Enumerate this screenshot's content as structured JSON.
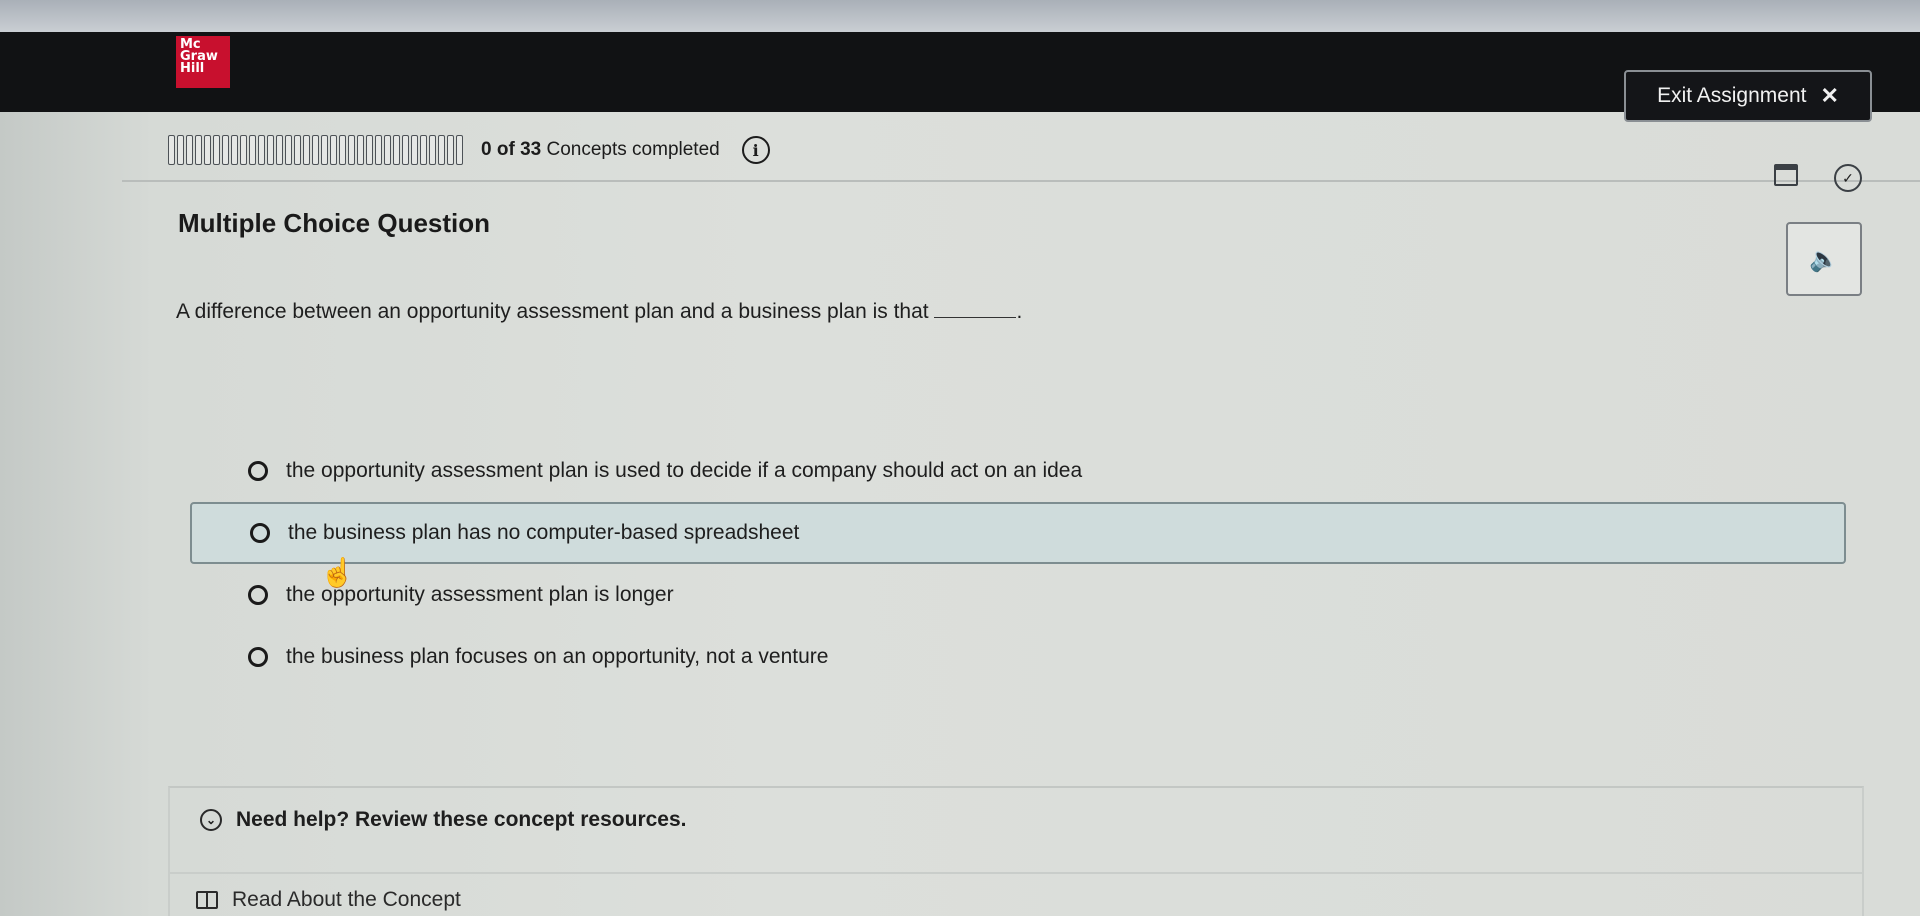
{
  "header": {
    "logo": {
      "line1": "Mc",
      "line2": "Graw",
      "line3": "Hill"
    },
    "exit_label": "Exit Assignment",
    "exit_icon": "close-icon"
  },
  "progress": {
    "completed": "0",
    "of_label": "of",
    "total": "33",
    "label": "Concepts completed",
    "segments": 33,
    "info_symbol": "i"
  },
  "question": {
    "heading": "Multiple Choice Question",
    "prompt": "A difference between an opportunity assessment plan and a business plan is that",
    "prompt_end": "."
  },
  "options": [
    {
      "label": "the opportunity assessment plan is used to decide if a company should act on an idea"
    },
    {
      "label": "the business plan has no computer-based spreadsheet"
    },
    {
      "label": "the opportunity assessment plan is longer"
    },
    {
      "label": "the business plan focuses on an opportunity, not a venture"
    }
  ],
  "help": {
    "toggle_label": "Need help? Review these concept resources.",
    "read_label": "Read About the Concept"
  },
  "icons": {
    "audio": "speaker-icon",
    "calendar": "calendar-icon",
    "clock": "clock-icon",
    "pointer": "hand-pointer-icon"
  },
  "colors": {
    "brand": "#c8102e",
    "header_bg": "#111214",
    "hover_option_bg": "#cfdcdc"
  }
}
